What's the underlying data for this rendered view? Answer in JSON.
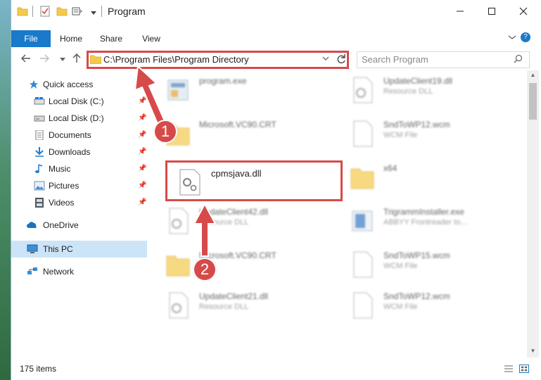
{
  "window": {
    "title": "Program"
  },
  "ribbon": {
    "tabs": [
      {
        "label": "File"
      },
      {
        "label": "Home"
      },
      {
        "label": "Share"
      },
      {
        "label": "View"
      }
    ]
  },
  "address": {
    "path": "C:\\Program Files\\Program Directory"
  },
  "search": {
    "placeholder": "Search Program"
  },
  "navpane": {
    "items": [
      {
        "label": "Quick access"
      },
      {
        "label": "Local Disk (C:)"
      },
      {
        "label": "Local Disk (D:)"
      },
      {
        "label": "Documents"
      },
      {
        "label": "Downloads"
      },
      {
        "label": "Music"
      },
      {
        "label": "Pictures"
      },
      {
        "label": "Videos"
      },
      {
        "label": "OneDrive"
      },
      {
        "label": "This PC"
      },
      {
        "label": "Network"
      }
    ]
  },
  "files": [
    {
      "name": "program.exe",
      "type": ""
    },
    {
      "name": "UpdateClient19.dll",
      "type": "Resource DLL"
    },
    {
      "name": "Microsoft.VC90.CRT",
      "type": ""
    },
    {
      "name": "SndToWP12.wcm",
      "type": "WCM File"
    },
    {
      "name": "cpmsjava.dll",
      "type": ""
    },
    {
      "name": "x64",
      "type": ""
    },
    {
      "name": "UpdateClient42.dll",
      "type": "Resource DLL"
    },
    {
      "name": "TrigrammInstaller.exe",
      "type": "ABBYY Frontreader to..."
    },
    {
      "name": "Microsoft.VC90.CRT",
      "type": ""
    },
    {
      "name": "SndToWP15.wcm",
      "type": "WCM File"
    },
    {
      "name": "UpdateClient21.dll",
      "type": "Resource DLL"
    },
    {
      "name": "SndToWP12.wcm",
      "type": "WCM File"
    }
  ],
  "status": {
    "item_count": "175 items"
  },
  "annotations": {
    "step1": "1",
    "step2": "2",
    "color": "#d74a4a"
  }
}
